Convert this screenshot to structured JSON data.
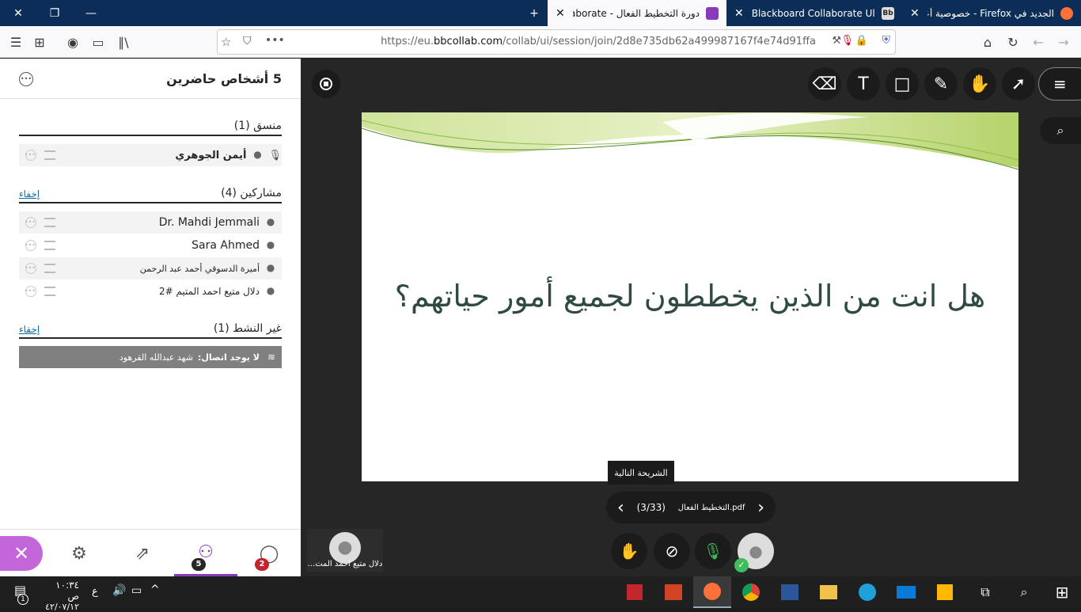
{
  "browser": {
    "tabs": [
      {
        "title": "الجديد في Firefox - خصوصية أعلى",
        "favicon_color": "#ff7139"
      },
      {
        "title": "Blackboard Collaborate Ultra -",
        "favicon_color": "#262626",
        "favicon_text": "Bb"
      },
      {
        "title": "دورة التخطيط الفعال - Collaborate",
        "favicon_color": "#8a3ab9"
      }
    ],
    "new_tab": "+",
    "url_prefix": "https://eu.",
    "url_host": "bbcollab.com",
    "url_path": "/collab/ui/session/join/2d8e735db62a499987167f4e74d91ffa"
  },
  "panel": {
    "title": "5 أشخاص حاضرين",
    "sections": {
      "moderator": {
        "header": "منسق (1)",
        "members": [
          "أيمن الجوهري"
        ]
      },
      "participants": {
        "header": "مشاركين (4)",
        "hide": "إخفاء",
        "members": [
          "Dr. Mahdi Jemmali",
          "Sara Ahmed",
          "أميرة الدسوقي أحمد عبد الرحمن",
          "دلال متيع احمد المتيم #2"
        ]
      },
      "inactive": {
        "header": "غير النشط (1)",
        "hide": "إخفاء",
        "label": "لا يوجد اتصال:",
        "member": "شهد عبدالله القرهود"
      }
    },
    "toolbar": {
      "chat_badge": "2",
      "attendees_badge": "5"
    }
  },
  "stage": {
    "slide_text": "هل انت من الذين يخططون لجميع أمور حياتهم؟",
    "tooltip": "الشريحة التالية",
    "file_name": "التخطيط الفعال.pdf",
    "page": "(3/33)",
    "self_name": "دلال متيع احمد المت..."
  },
  "taskbar": {
    "time": "١٠:٣٤ ص",
    "date": "٤٢/٠٧/١٢",
    "lang": "ع",
    "notif": "1"
  },
  "colors": {
    "accent": "#8a3ab9",
    "close_button": "#c266d9",
    "badge": "#c4262e"
  }
}
